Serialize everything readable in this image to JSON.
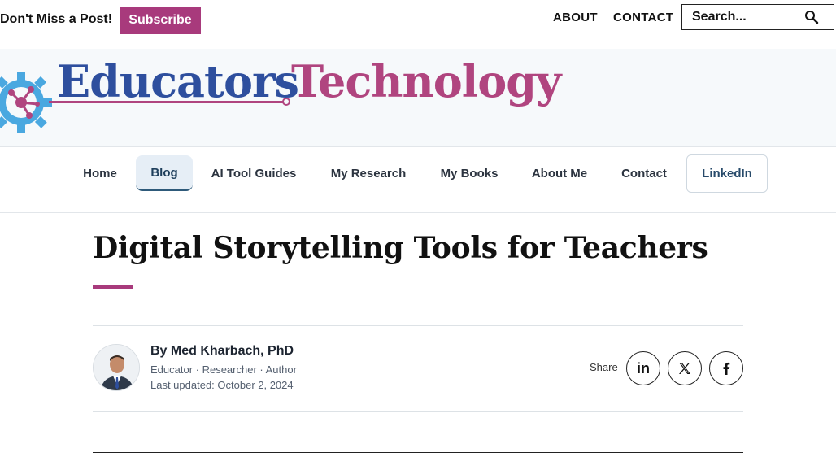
{
  "topbar": {
    "promo_text": "Don't Miss a Post!",
    "subscribe_label": "Subscribe",
    "links": [
      "ABOUT",
      "CONTACT"
    ],
    "search_placeholder": "Search..."
  },
  "logo": {
    "word1": "Educators",
    "word2": "Technology",
    "colors": {
      "word1": "#2e4f9e",
      "word2": "#b0457f",
      "gear": "#4aa8e0"
    }
  },
  "nav": {
    "items": [
      "Home",
      "Blog",
      "AI Tool Guides",
      "My Research",
      "My Books",
      "About Me",
      "Contact",
      "LinkedIn"
    ],
    "active": "Blog"
  },
  "article": {
    "title": "Digital Storytelling Tools for Teachers",
    "author_name": "By Med Kharbach, PhD",
    "author_role": "Educator · Researcher · Author",
    "last_updated": "Last updated: October 2, 2024",
    "share_label": "Share",
    "share_icons": [
      "linkedin-icon",
      "x-icon",
      "facebook-icon"
    ]
  },
  "colors": {
    "accent": "#a83a7c",
    "text": "#111111"
  }
}
